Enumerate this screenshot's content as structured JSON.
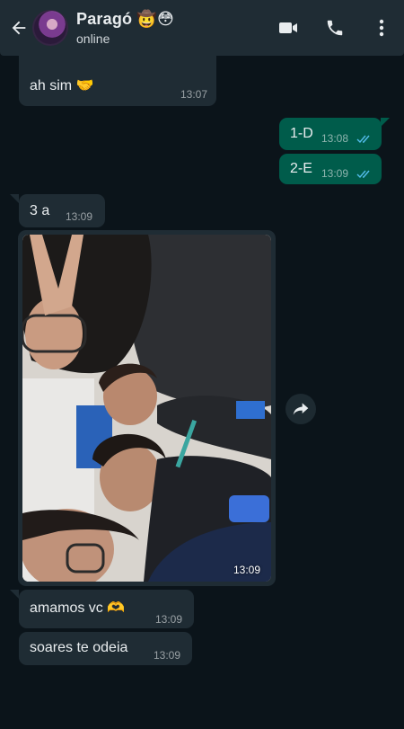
{
  "header": {
    "contact_name": "Paragó 🤠😳",
    "status": "online"
  },
  "messages": [
    {
      "type": "in",
      "text": "ah sim 🤝",
      "time": "13:07"
    },
    {
      "type": "out",
      "text": "1-D",
      "time": "13:08"
    },
    {
      "type": "out",
      "text": "2-E",
      "time": "13:09"
    },
    {
      "type": "in",
      "text": "3 a",
      "time": "13:09"
    },
    {
      "type": "in-image",
      "time": "13:09"
    },
    {
      "type": "in",
      "text": "amamos vc 🫶",
      "time": "13:09"
    },
    {
      "type": "in",
      "text": "soares te odeia",
      "time": "13:09"
    }
  ],
  "colors": {
    "background": "#0b141a",
    "header": "#1f2c34",
    "incoming": "#1f2c34",
    "outgoing": "#005c4b",
    "read_ticks": "#53bdeb"
  }
}
